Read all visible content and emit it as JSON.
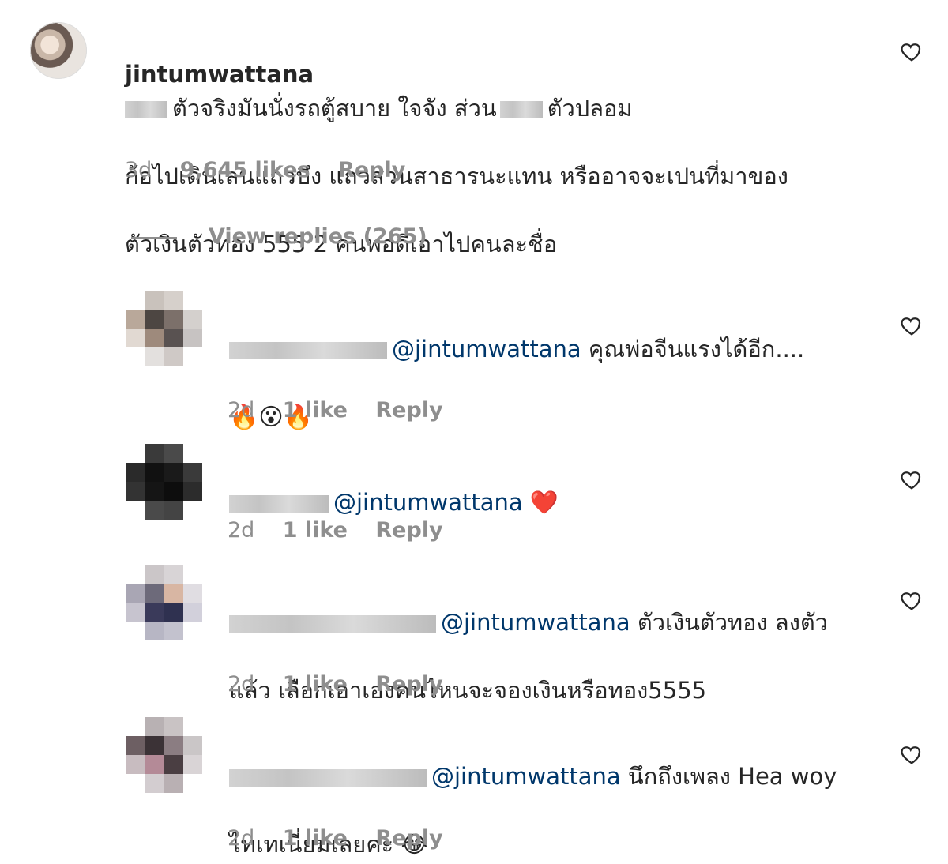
{
  "colors": {
    "text": "#262626",
    "meta": "#8e8e8e",
    "mention": "#00376b",
    "heart_red": "#ed4956"
  },
  "main_comment": {
    "username": "jintumwattana",
    "text_line1": "ตัวจริงมันนั่งรถตู้สบาย ใจจัง ส่วน",
    "text_line1b": "ตัวปลอม",
    "text_line2": "ก้อไปเดินเล่นแถวบึง แถวสวนสาธารนะแทน หรืออาจจะเปนที่มาของ",
    "text_line3": "ตัวเงินตัวทอง 555 2 คนพอดีเอาไปคนละชื่อ",
    "time": "3d",
    "likes": "9,645 likes",
    "reply": "Reply",
    "view_replies": "View replies (265)",
    "heart_icon": "heart-outline-icon"
  },
  "replies": [
    {
      "mention": "@jintumwattana",
      "text_line1": " คุณพ่อจีนแรงได้อีก....",
      "emojis": "🔥😮🔥",
      "time": "2d",
      "likes": "1 like",
      "reply": "Reply"
    },
    {
      "mention": "@jintumwattana",
      "text_line1": " ❤️",
      "time": "2d",
      "likes": "1 like",
      "reply": "Reply"
    },
    {
      "mention": "@jintumwattana",
      "text_line1": " ตัวเงินตัวทอง ลงตัว",
      "text_line2": "แล้ว เลือกเอาเองคนไหนจะจองเงินหรือทอง5555",
      "time": "2d",
      "likes": "1 like",
      "reply": "Reply"
    },
    {
      "mention": "@jintumwattana",
      "text_line1": " นึกถึงเพลง Hea woy",
      "text_line2": "ไทเทเนี่ยมเลยค่ะ 😂",
      "time": "2d",
      "likes": "1 like",
      "reply": "Reply"
    }
  ]
}
